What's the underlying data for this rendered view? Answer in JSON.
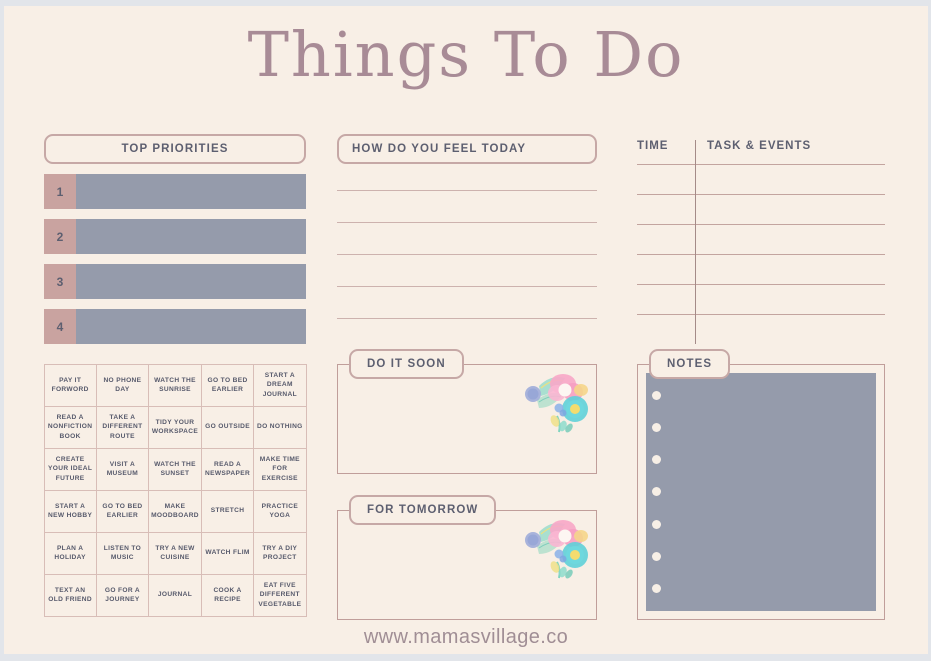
{
  "title": "Things To Do",
  "top_priorities": {
    "header": "TOP PRIORITIES",
    "rows": [
      {
        "number": "1"
      },
      {
        "number": "2"
      },
      {
        "number": "3"
      },
      {
        "number": "4"
      }
    ]
  },
  "feel_today": {
    "header": "HOW DO YOU FEEL TODAY",
    "line_count": 5
  },
  "schedule": {
    "col_time": "TIME",
    "col_task": "TASK & EVENTS",
    "row_count": 6
  },
  "activity_grid": {
    "cells": [
      "PAY IT FORWORD",
      "NO PHONE DAY",
      "WATCH THE SUNRISE",
      "GO TO BED EARLIER",
      "START A DREAM JOURNAL",
      "READ A NONFICTION BOOK",
      "TAKE A DIFFERENT ROUTE",
      "TIDY YOUR WORKSPACE",
      "GO OUTSIDE",
      "DO NOTHING",
      "CREATE YOUR IDEAL FUTURE",
      "VISIT A MUSEUM",
      "WATCH THE SUNSET",
      "READ A NEWSPAPER",
      "MAKE TIME FOR EXERCISE",
      "START A NEW HOBBY",
      "GO TO BED EARLIER",
      "MAKE MOODBOARD",
      "STRETCH",
      "PRACTICE YOGA",
      "PLAN A HOLIDAY",
      "LISTEN TO MUSIC",
      "TRY A NEW CUISINE",
      "WATCH FLIM",
      "TRY A DIY PROJECT",
      "TEXT AN OLD FRIEND",
      "GO FOR A JOURNEY",
      "JOURNAL",
      "COOK A RECIPE",
      "EAT FIVE DIFFERENT VEGETABLE"
    ]
  },
  "do_it_soon": {
    "header": "DO IT SOON"
  },
  "for_tomorrow": {
    "header": "FOR TOMORROW"
  },
  "notes": {
    "header": "NOTES",
    "bullet_count": 7
  },
  "footer": {
    "url": "www.mamasvillage.co"
  },
  "colors": {
    "page_background": "#f8efe6",
    "backdrop": "#e2e5ea",
    "accent_rose": "#c6a8a6",
    "number_box": "#c9a3a0",
    "bar_fill": "#959bab",
    "text_slate": "#5d5f70",
    "title_mauve": "#a88b96"
  }
}
